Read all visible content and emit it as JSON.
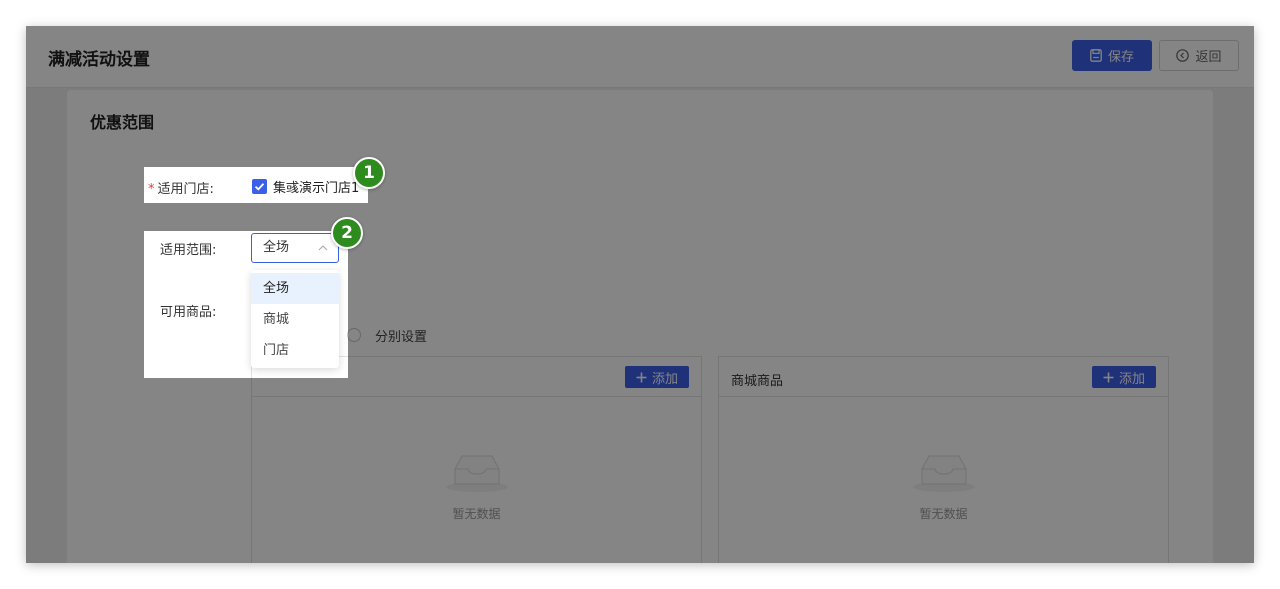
{
  "header": {
    "title": "满减活动设置",
    "save_label": "保存",
    "back_label": "返回"
  },
  "section": {
    "title": "优惠范围"
  },
  "form": {
    "store_label": "适用门店:",
    "store_required_mark": "*",
    "store_checkbox_label": "集彧演示门店1",
    "store_checked": true,
    "scope_label": "适用范围:",
    "scope_value": "全场",
    "goods_label": "可用商品:",
    "goods_option_separate": "分别设置"
  },
  "dropdown": {
    "options": [
      "全场",
      "商城",
      "门店"
    ],
    "selected_index": 0
  },
  "panels": [
    {
      "title": "",
      "add_label": "添加",
      "empty_text": "暂无数据"
    },
    {
      "title": "商城商品",
      "add_label": "添加",
      "empty_text": "暂无数据"
    }
  ],
  "callouts": [
    "1",
    "2"
  ],
  "colors": {
    "primary": "#3a5fe8",
    "required": "#e53935",
    "badge": "#2e8b1e",
    "overlay": "rgba(0,0,0,0.48)"
  }
}
